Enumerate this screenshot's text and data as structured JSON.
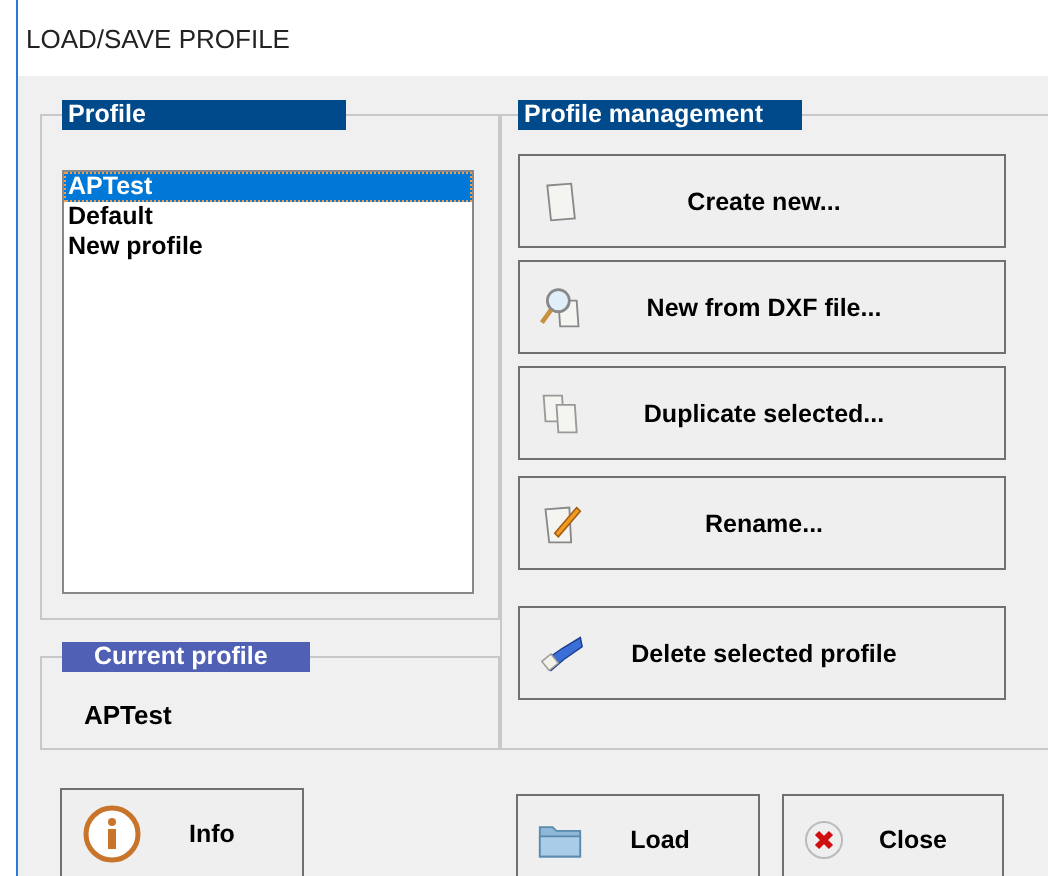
{
  "window": {
    "title": "LOAD/SAVE PROFILE"
  },
  "profile_list": {
    "title": "Profile",
    "items": [
      {
        "label": "APTest",
        "selected": true
      },
      {
        "label": "Default",
        "selected": false
      },
      {
        "label": "New profile",
        "selected": false
      }
    ]
  },
  "current_profile": {
    "title": "Current profile",
    "value": "APTest"
  },
  "profile_management": {
    "title": "Profile management",
    "buttons": [
      {
        "label": "Create new...",
        "kind": "page"
      },
      {
        "label": "New from DXF file...",
        "kind": "magnifier"
      },
      {
        "label": "Duplicate selected...",
        "kind": "copy"
      },
      {
        "label": "Rename...",
        "kind": "edit"
      },
      {
        "label": "Delete selected profile",
        "kind": "eraser"
      }
    ]
  },
  "bottom_buttons": [
    {
      "label": "Info",
      "kind": "info"
    },
    {
      "label": "Load",
      "kind": "folder"
    },
    {
      "label": "Close",
      "kind": "close"
    }
  ]
}
